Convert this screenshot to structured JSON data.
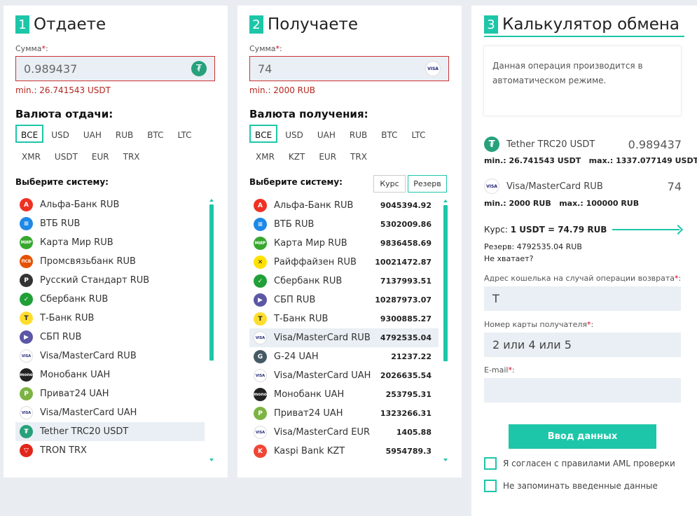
{
  "give": {
    "step_num": "1",
    "title": "Отдаете",
    "amount_label": "Сумма",
    "amount_value": "0.989437",
    "min_text": "min.: 26.741543 USDT",
    "currency_heading": "Валюта отдачи:",
    "currency_tags": [
      "ВСЕ",
      "USD",
      "UAH",
      "RUB",
      "BTC",
      "LTC",
      "XMR",
      "USDT",
      "EUR",
      "TRX"
    ],
    "system_heading": "Выберите систему:",
    "systems": [
      {
        "name": "Альфа-Банк RUB",
        "icon": "alfa-icon",
        "color": "#ef3124",
        "glyph": "А"
      },
      {
        "name": "ВТБ RUB",
        "icon": "vtb-icon",
        "color": "#1e88e5",
        "glyph": "≡"
      },
      {
        "name": "Карта Мир RUB",
        "icon": "mir-icon",
        "color": "#37a72e",
        "glyph": "МИР"
      },
      {
        "name": "Промсвязьбанк RUB",
        "icon": "psb-icon",
        "color": "#e65100",
        "glyph": "ПСБ"
      },
      {
        "name": "Русский Стандарт RUB",
        "icon": "russtandart-icon",
        "color": "#333333",
        "glyph": "Р"
      },
      {
        "name": "Сбербанк RUB",
        "icon": "sber-icon",
        "color": "#21a038",
        "glyph": "✓"
      },
      {
        "name": "Т-Банк RUB",
        "icon": "tbank-icon",
        "color": "#ffdd2d",
        "glyph": "Т"
      },
      {
        "name": "СБП RUB",
        "icon": "sbp-icon",
        "color": "#5b57a6",
        "glyph": "▶"
      },
      {
        "name": "Visa/MasterCard RUB",
        "icon": "visa-icon",
        "color": "#1a1f71",
        "glyph": "VISA"
      },
      {
        "name": "Монобанк UAH",
        "icon": "monobank-icon",
        "color": "#222222",
        "glyph": "mono"
      },
      {
        "name": "Приват24 UAH",
        "icon": "privat24-icon",
        "color": "#7cb342",
        "glyph": "P"
      },
      {
        "name": "Visa/MasterCard UAH",
        "icon": "visa-icon",
        "color": "#1a1f71",
        "glyph": "VISA"
      },
      {
        "name": "Tether TRC20 USDT",
        "icon": "tether-icon",
        "color": "#26a17b",
        "glyph": "₮"
      },
      {
        "name": "TRON TRX",
        "icon": "tron-icon",
        "color": "#e0261b",
        "glyph": "▽"
      }
    ]
  },
  "receive": {
    "step_num": "2",
    "title": "Получаете",
    "amount_label": "Сумма",
    "amount_value": "74",
    "min_text": "min.: 2000 RUB",
    "currency_heading": "Валюта получения:",
    "currency_tags": [
      "ВСЕ",
      "USD",
      "UAH",
      "RUB",
      "BTC",
      "LTC",
      "XMR",
      "KZT",
      "EUR",
      "TRX"
    ],
    "system_heading": "Выберите систему:",
    "sort_rate": "Курс",
    "sort_reserve": "Резерв",
    "systems": [
      {
        "name": "Альфа-Банк RUB",
        "reserve": "9045394.92",
        "icon": "alfa-icon",
        "color": "#ef3124",
        "glyph": "А"
      },
      {
        "name": "ВТБ RUB",
        "reserve": "5302009.86",
        "icon": "vtb-icon",
        "color": "#1e88e5",
        "glyph": "≡"
      },
      {
        "name": "Карта Мир RUB",
        "reserve": "9836458.69",
        "icon": "mir-icon",
        "color": "#37a72e",
        "glyph": "МИР"
      },
      {
        "name": "Райффайзен RUB",
        "reserve": "10021472.87",
        "icon": "raiffeisen-icon",
        "color": "#ffe100",
        "glyph": "✕"
      },
      {
        "name": "Сбербанк RUB",
        "reserve": "7137993.51",
        "icon": "sber-icon",
        "color": "#21a038",
        "glyph": "✓"
      },
      {
        "name": "СБП RUB",
        "reserve": "10287973.07",
        "icon": "sbp-icon",
        "color": "#5b57a6",
        "glyph": "▶"
      },
      {
        "name": "Т-Банк RUB",
        "reserve": "9300885.27",
        "icon": "tbank-icon",
        "color": "#ffdd2d",
        "glyph": "Т"
      },
      {
        "name": "Visa/MasterCard RUB",
        "reserve": "4792535.04",
        "icon": "visa-icon",
        "color": "#1a1f71",
        "glyph": "VISA"
      },
      {
        "name": "G-24 UAH",
        "reserve": "21237.22",
        "icon": "g24-icon",
        "color": "#455a64",
        "glyph": "G"
      },
      {
        "name": "Visa/MasterCard UAH",
        "reserve": "2026635.54",
        "icon": "visa-icon",
        "color": "#1a1f71",
        "glyph": "VISA"
      },
      {
        "name": "Монобанк UAH",
        "reserve": "253795.31",
        "icon": "monobank-icon",
        "color": "#222222",
        "glyph": "mono"
      },
      {
        "name": "Приват24 UAH",
        "reserve": "1323266.31",
        "icon": "privat24-icon",
        "color": "#7cb342",
        "glyph": "P"
      },
      {
        "name": "Visa/MasterCard EUR",
        "reserve": "1405.88",
        "icon": "visa-icon",
        "color": "#1a1f71",
        "glyph": "VISA"
      },
      {
        "name": "Kaspi Bank KZT",
        "reserve": "5954789.3",
        "icon": "kaspi-icon",
        "color": "#f14635",
        "glyph": "K"
      }
    ]
  },
  "calc": {
    "step_num": "3",
    "title": "Калькулятор обмена",
    "info_text": "Данная операция производится в автоматическом режиме.",
    "from_name": "Tether TRC20 USDT",
    "from_value": "0.989437",
    "from_limits": "min.: 26.741543 USDT   max.: 1337.077149 USDT",
    "to_name": "Visa/MasterCard RUB",
    "to_value": "74",
    "to_limits": "min.: 2000 RUB   max.: 100000 RUB",
    "course_label": "Курс:",
    "course_value": "1 USDT = 74.79 RUB",
    "reserve_text": "Резерв: 4792535.04 RUB",
    "not_enough": "Не хватает?",
    "wallet_label": "Адрес кошелька на случай операции возврата",
    "wallet_value": "Т",
    "card_label": "Номер карты получателя",
    "card_value": "2 или 4 или 5",
    "email_label": "E-mail",
    "email_value": "",
    "submit_label": "Ввод данных",
    "aml_label": "Я согласен с правилами AML проверки",
    "remember_label": "Не запоминать введенные данные"
  },
  "colors": {
    "accent": "#1dc6a8",
    "error": "#b3261e"
  }
}
